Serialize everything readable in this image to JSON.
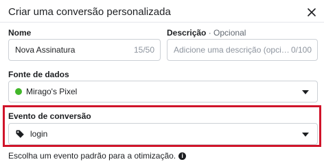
{
  "dialog": {
    "title": "Criar uma conversão personalizada",
    "close_icon": "close-icon"
  },
  "name_field": {
    "label": "Nome",
    "value": "Nova Assinatura",
    "counter": "15/50"
  },
  "description_field": {
    "label": "Descrição",
    "optional_label": "· Opcional",
    "placeholder": "Adicione uma descrição (opcio...",
    "counter": "0/100"
  },
  "data_source": {
    "label": "Fonte de dados",
    "selected": "Mirago's Pixel",
    "status_color": "#42b72a",
    "icon": "status-dot-icon"
  },
  "conversion_event": {
    "label": "Evento de conversão",
    "selected": "login",
    "icon": "tag-icon",
    "highlight_color": "#d0142a"
  },
  "helper": {
    "text": "Escolha um evento padrão para a otimização.",
    "icon": "info-icon"
  }
}
